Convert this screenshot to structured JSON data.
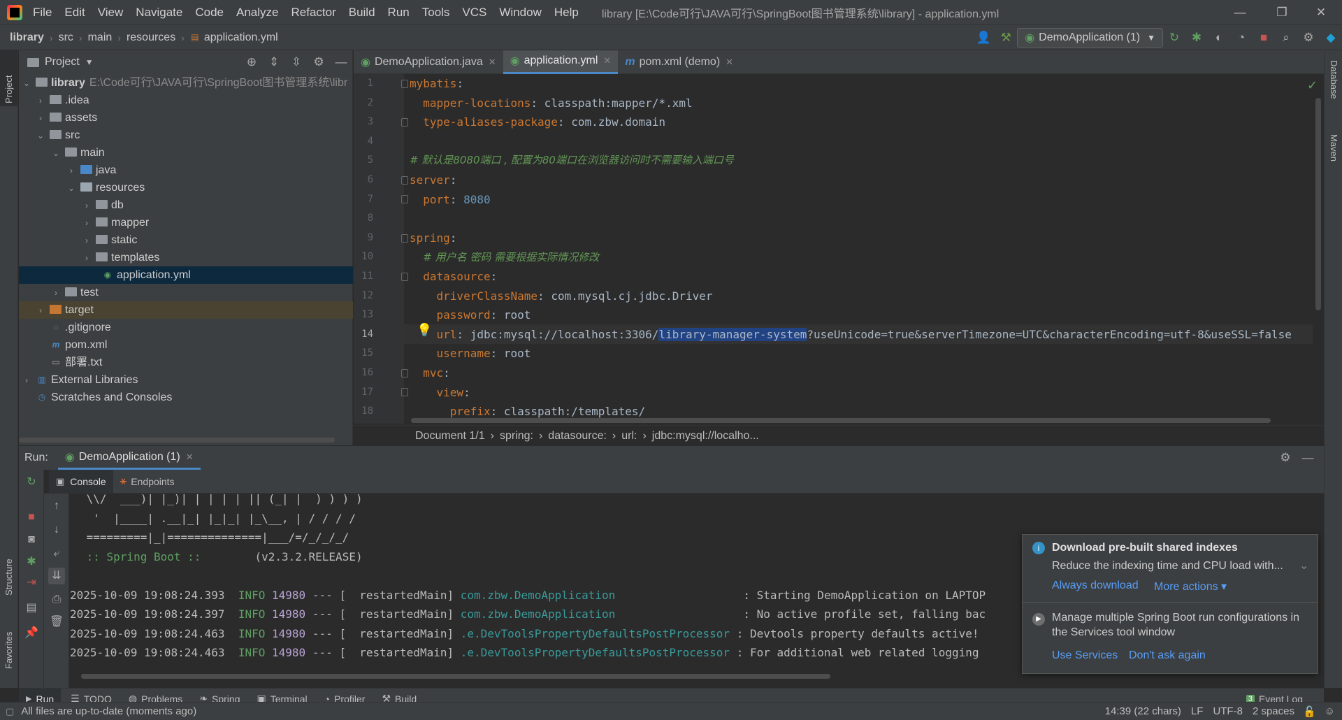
{
  "menu": {
    "items": [
      "File",
      "Edit",
      "View",
      "Navigate",
      "Code",
      "Analyze",
      "Refactor",
      "Build",
      "Run",
      "Tools",
      "VCS",
      "Window",
      "Help"
    ],
    "window_title": "library [E:\\Code可行\\JAVA可行\\SpringBoot图书管理系统\\library] - application.yml"
  },
  "nav": {
    "crumbs": [
      "library",
      "src",
      "main",
      "resources",
      "application.yml"
    ],
    "run_config": "DemoApplication (1)"
  },
  "project": {
    "title": "Project",
    "rows": [
      {
        "label": "library",
        "path": "E:\\Code可行\\JAVA可行\\SpringBoot图书管理系统\\libr"
      },
      {
        "label": ".idea"
      },
      {
        "label": "assets"
      },
      {
        "label": "src"
      },
      {
        "label": "main"
      },
      {
        "label": "java"
      },
      {
        "label": "resources"
      },
      {
        "label": "db"
      },
      {
        "label": "mapper"
      },
      {
        "label": "static"
      },
      {
        "label": "templates"
      },
      {
        "label": "application.yml"
      },
      {
        "label": "test"
      },
      {
        "label": "target"
      },
      {
        "label": ".gitignore"
      },
      {
        "label": "pom.xml"
      },
      {
        "label": "部署.txt"
      },
      {
        "label": "External Libraries"
      },
      {
        "label": "Scratches and Consoles"
      }
    ]
  },
  "side": {
    "left_project": "Project",
    "left_structure": "Structure",
    "left_favorites": "Favorites",
    "right_database": "Database",
    "right_maven": "Maven"
  },
  "tabs": [
    {
      "label": "DemoApplication.java"
    },
    {
      "label": "application.yml"
    },
    {
      "label": "pom.xml (demo)"
    }
  ],
  "editor": {
    "line_numbers": [
      "1",
      "2",
      "3",
      "4",
      "5",
      "6",
      "7",
      "8",
      "9",
      "10",
      "11",
      "12",
      "13",
      "14",
      "15",
      "16",
      "17",
      "18"
    ],
    "l1k": "mybatis",
    "colon": ":",
    "l2k": "mapper-locations",
    "l2v": "classpath:mapper/*.xml",
    "l3k": "type-aliases-package",
    "l3v": "com.zbw.domain",
    "l5": "# 默认是8080端口 , 配置为80端口在浏览器访问时不需要输入端口号",
    "l6k": "server",
    "l7k": "port",
    "l7v": "8080",
    "l9k": "spring",
    "l10": "# 用户名 密码 需要根据实际情况修改",
    "l11k": "datasource",
    "l12k": "driverClassName",
    "l12v": "com.mysql.cj.jdbc.Driver",
    "l13k": "password",
    "l13v": "root",
    "l14k": "url",
    "l14a": "jdbc:mysql://localhost:3306/",
    "l14sel": "library-manager-system",
    "l14b": "?useUnicode=true&serverTimezone=UTC&characterEncoding=utf-8&useSSL=false",
    "l15k": "username",
    "l15v": "root",
    "l16k": "mvc",
    "l17k": "view",
    "l18k": "prefix",
    "l18v": "classpath:/templates/"
  },
  "editor_crumbs": [
    "Document 1/1",
    "spring:",
    "datasource:",
    "url:",
    "jdbc:mysql://localho..."
  ],
  "run": {
    "label": "Run:",
    "tab": "DemoApplication (1)",
    "console_tab": "Console",
    "endpoints_tab": "Endpoints"
  },
  "console": {
    "banner": [
      " \\\\/  ___)| |_)| | | | | || (_| |  ) ) ) )",
      "  '  |____| .__|_| |_|_| |_\\__, | / / / /",
      " =========|_|==============|___/=/_/_/_/"
    ],
    "boot_label": " :: Spring Boot :: ",
    "boot_version": "       (v2.3.2.RELEASE)",
    "logs": [
      {
        "ts": "2025-10-09 19:08:24.393",
        "lvl": "INFO",
        "pid": "14980",
        "thread": "--- [  restartedMain]",
        "cls": "com.zbw.DemoApplication                  ",
        "msg": ": Starting DemoApplication on LAPTOP"
      },
      {
        "ts": "2025-10-09 19:08:24.397",
        "lvl": "INFO",
        "pid": "14980",
        "thread": "--- [  restartedMain]",
        "cls": "com.zbw.DemoApplication                  ",
        "msg": ": No active profile set, falling bac"
      },
      {
        "ts": "2025-10-09 19:08:24.463",
        "lvl": "INFO",
        "pid": "14980",
        "thread": "--- [  restartedMain]",
        "cls": ".e.DevToolsPropertyDefaultsPostProcessor",
        "msg": ": Devtools property defaults active!"
      },
      {
        "ts": "2025-10-09 19:08:24.463",
        "lvl": "INFO",
        "pid": "14980",
        "thread": "--- [  restartedMain]",
        "cls": ".e.DevToolsPropertyDefaultsPostProcessor",
        "msg": ": For additional web related logging"
      }
    ]
  },
  "notification": {
    "title": "Download pre-built shared indexes",
    "body": "Reduce the indexing time and CPU load with...",
    "action1": "Always download",
    "action2": "More actions ▾",
    "title2": "Manage multiple Spring Boot run configurations in the Services tool window",
    "action3": "Use Services",
    "action4": "Don't ask again"
  },
  "bottom_tools": [
    "Run",
    "TODO",
    "Problems",
    "Spring",
    "Terminal",
    "Profiler",
    "Build"
  ],
  "event_log": {
    "count": "3",
    "label": "Event Log"
  },
  "status": {
    "message": "All files are up-to-date (moments ago)",
    "position": "14:39 (22 chars)",
    "line_sep": "LF",
    "encoding": "UTF-8",
    "indent": "2 spaces"
  },
  "colors": {
    "keyword": "#cc7832",
    "string": "#a9b7c6",
    "comment": "#629755",
    "number": "#6897bb",
    "selection": "#214283",
    "link": "#589df6"
  }
}
